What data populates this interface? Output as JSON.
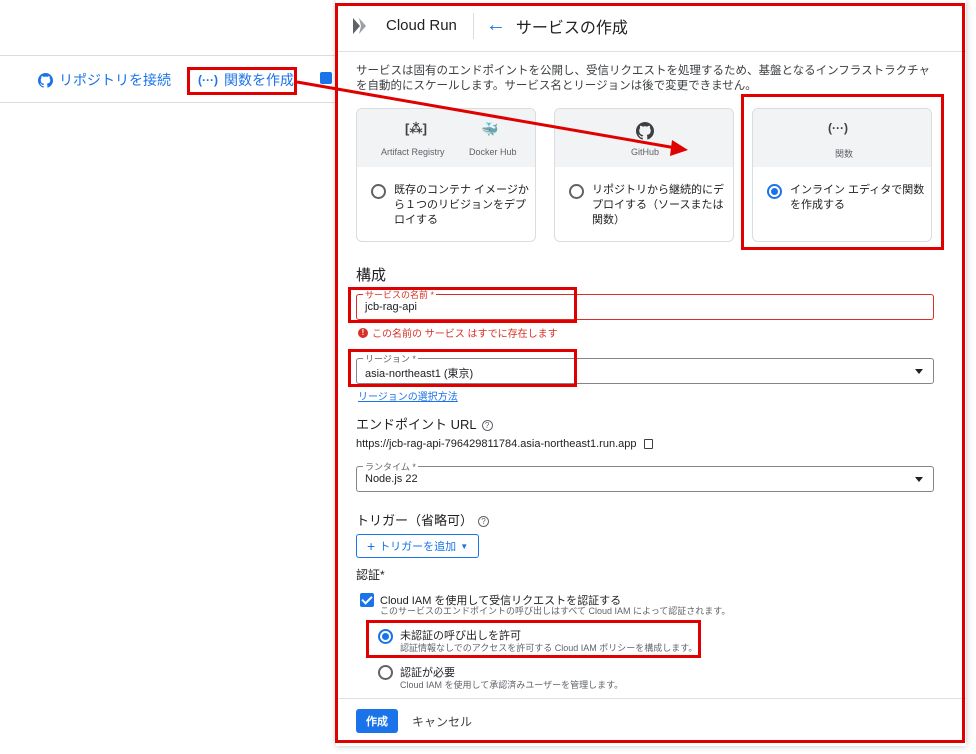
{
  "background": {
    "connect_repo": "リポジトリを接続",
    "create_function": "関数を作成"
  },
  "header": {
    "product": "Cloud Run",
    "title": "サービスの作成"
  },
  "description": "サービスは固有のエンドポイントを公開し、受信リクエストを処理するため、基盤となるインフラストラクチャを自動的にスケールします。サービス名とリージョンは後で変更できません。",
  "cards": [
    {
      "sub1": "Artifact Registry",
      "sub2": "Docker Hub",
      "text": "既存のコンテナ イメージから１つのリビジョンをデプロイする"
    },
    {
      "sub1": "GitHub",
      "text": "リポジトリから継続的にデプロイする（ソースまたは関数）"
    },
    {
      "sub1": "関数",
      "text": "インライン エディタで関数を作成する"
    }
  ],
  "config": {
    "heading": "構成",
    "service_name_label": "サービスの名前 *",
    "service_name_value": "jcb-rag-api",
    "service_name_error": "この名前の サービス はすでに存在します",
    "region_label": "リージョン *",
    "region_value": "asia-northeast1 (東京)",
    "region_link": "リージョンの選択方法",
    "endpoint_heading": "エンドポイント URL",
    "endpoint_url": "https://jcb-rag-api-796429811784.asia-northeast1.run.app",
    "runtime_label": "ランタイム *",
    "runtime_value": "Node.js 22",
    "trigger_heading": "トリガー（省略可）",
    "add_trigger": "トリガーを追加",
    "auth_heading": "認証*",
    "iam_label": "Cloud IAM を使用して受信リクエストを認証する",
    "iam_sub": "このサービスのエンドポイントの呼び出しはすべて Cloud IAM によって認証されます。",
    "allow_unauth": "未認証の呼び出しを許可",
    "allow_unauth_sub": "認証情報なしでのアクセスを許可する Cloud IAM ポリシーを構成します。",
    "require_auth": "認証が必要",
    "require_auth_sub": "Cloud IAM を使用して承認済みユーザーを管理します。"
  },
  "footer": {
    "create": "作成",
    "cancel": "キャンセル"
  },
  "colors": {
    "accent": "#1a73e8",
    "highlight": "#e00000",
    "error": "#d93025"
  }
}
